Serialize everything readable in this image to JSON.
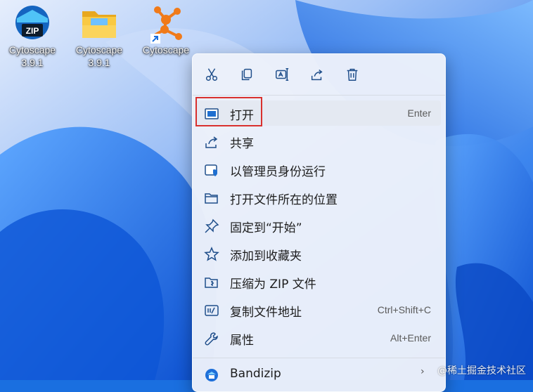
{
  "desktop": {
    "icons": [
      {
        "label_line1": "Cytoscape",
        "label_line2": "3.9.1",
        "icon": "zip-archive-icon",
        "badge": "ZIP"
      },
      {
        "label_line1": "Cytoscape",
        "label_line2": "3.9.1",
        "icon": "folder-icon"
      },
      {
        "label_line1": "Cytoscape",
        "label_line2": "",
        "icon": "cytoscape-shortcut-icon"
      }
    ]
  },
  "context_menu": {
    "quick_actions": [
      "cut-icon",
      "copy-icon",
      "rename-icon",
      "share-icon",
      "delete-icon"
    ],
    "items": [
      {
        "label": "打开",
        "shortcut": "Enter",
        "icon": "open-app-icon"
      },
      {
        "label": "共享",
        "shortcut": "",
        "icon": "share-icon"
      },
      {
        "label": "以管理员身份运行",
        "shortcut": "",
        "icon": "admin-shield-icon"
      },
      {
        "label": "打开文件所在的位置",
        "shortcut": "",
        "icon": "folder-outline-icon"
      },
      {
        "label": "固定到“开始”",
        "shortcut": "",
        "icon": "pin-icon"
      },
      {
        "label": "添加到收藏夹",
        "shortcut": "",
        "icon": "star-icon"
      },
      {
        "label": "压缩为 ZIP 文件",
        "shortcut": "",
        "icon": "zip-folder-icon"
      },
      {
        "label": "复制文件地址",
        "shortcut": "Ctrl+Shift+C",
        "icon": "copy-path-icon"
      },
      {
        "label": "属性",
        "shortcut": "Alt+Enter",
        "icon": "wrench-icon"
      },
      {
        "label": "Bandizip",
        "shortcut": "",
        "icon": "bandizip-icon"
      }
    ]
  },
  "watermark": "@稀土掘金技术社区",
  "colors": {
    "accent": "#0067c0",
    "highlight_border": "#d9312e",
    "wallpaper": "#1a6fe0"
  }
}
